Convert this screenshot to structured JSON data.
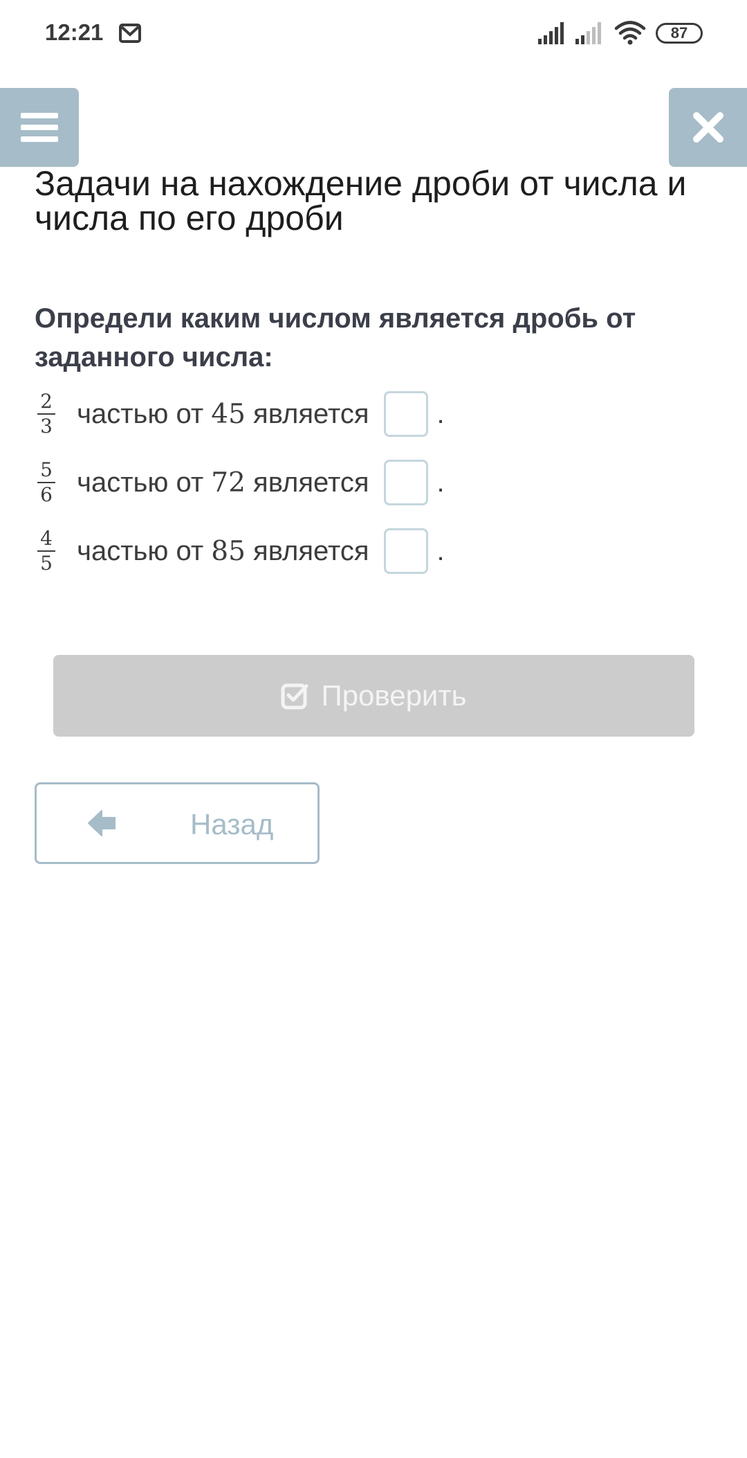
{
  "status_bar": {
    "time": "12:21",
    "battery": "87",
    "icons": [
      "mail-icon",
      "signal-icon",
      "signal-icon",
      "wifi-icon",
      "battery-icon"
    ]
  },
  "header": {
    "menu_icon": "hamburger-menu-icon",
    "close_icon": "close-icon",
    "accent_color": "#a6bcc8"
  },
  "page": {
    "title": "Задачи на нахождение дроби от числа и числа по его дроби",
    "question": "Определи каким числом является дробь от заданного числа:"
  },
  "tasks": [
    {
      "numerator": "2",
      "denominator": "3",
      "text_before": " частью от ",
      "number": "45",
      "text_after": " является",
      "answer": "",
      "end": "."
    },
    {
      "numerator": "5",
      "denominator": "6",
      "text_before": " частью от ",
      "number": "72",
      "text_after": " является",
      "answer": "",
      "end": "."
    },
    {
      "numerator": "4",
      "denominator": "5",
      "text_before": " частью от ",
      "number": "85",
      "text_after": " является",
      "answer": "",
      "end": "."
    }
  ],
  "actions": {
    "check_label": "Проверить",
    "check_icon": "checkbox-check-icon",
    "check_disabled": true,
    "back_label": "Назад",
    "back_icon": "arrow-left-icon"
  }
}
